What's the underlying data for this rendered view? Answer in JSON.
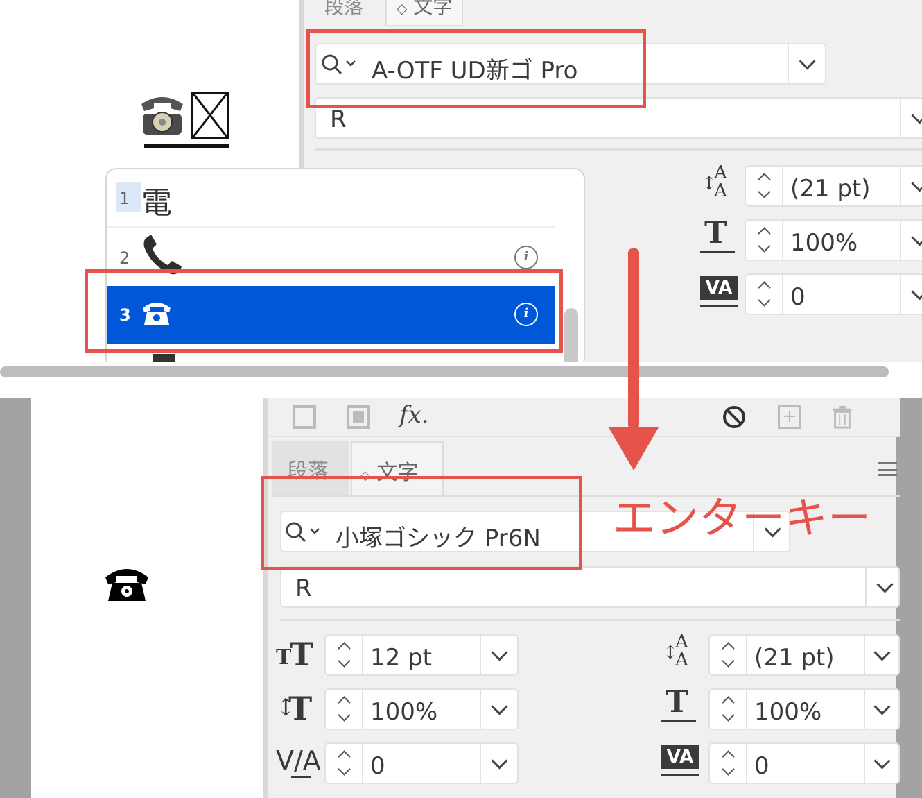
{
  "top": {
    "canvas_glyph": "☎",
    "tabs": {
      "paragraph": "段落",
      "character": "文字"
    },
    "font_name": "A-OTF UD新ゴ Pro",
    "font_style": "R",
    "leading": "(21 pt)",
    "horizontal_scale": "100%",
    "tracking": "0",
    "glyph_list": [
      {
        "number": "1",
        "glyph": "電"
      },
      {
        "number": "2",
        "glyph": "📞"
      },
      {
        "number": "3",
        "glyph": "☎"
      }
    ]
  },
  "bottom": {
    "canvas_glyph": "☎",
    "tabs": {
      "paragraph": "段落",
      "character": "文字"
    },
    "font_name": "小塚ゴシック Pr6N",
    "font_style": "R",
    "font_size": "12 pt",
    "leading": "(21 pt)",
    "vertical_scale": "100%",
    "horizontal_scale": "100%",
    "kerning": "0",
    "tracking": "0"
  },
  "annotation": {
    "label": "エンターキー",
    "color": "#e5534b"
  },
  "colors": {
    "selection": "#0057d8",
    "highlight_box": "#e5534b"
  }
}
